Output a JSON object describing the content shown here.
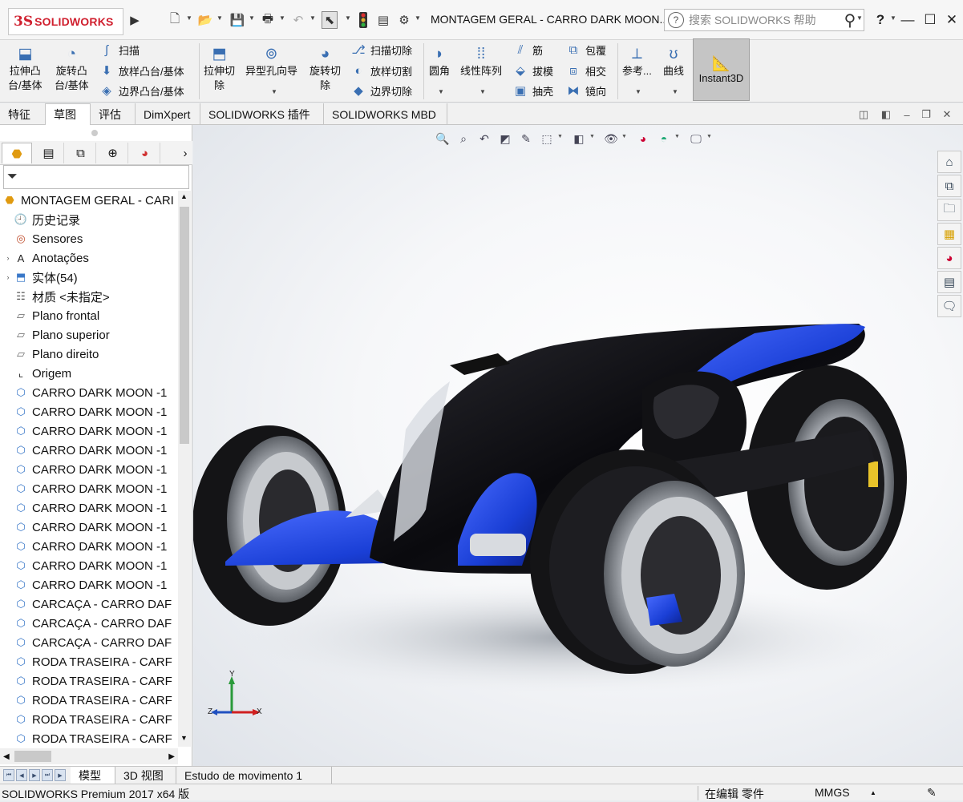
{
  "app": {
    "logo_mark": "3S",
    "logo_text": "SOLIDWORKS",
    "window_title": "MONTAGEM GERAL - CARRO DARK MOON...",
    "search_placeholder": "搜索 SOLIDWORKS 帮助",
    "help_glyph": "?"
  },
  "ribbon": {
    "extrude_boss": "拉伸凸\n台/基体",
    "revolve_boss": "旋转凸\n台/基体",
    "sweep": "扫描",
    "loft_boss": "放样凸台/基体",
    "boundary_boss": "边界凸台/基体",
    "extrude_cut": "拉伸切\n除",
    "hole_wizard": "异型孔向导",
    "revolve_cut": "旋转切\n除",
    "swept_cut": "扫描切除",
    "lofted_cut": "放样切割",
    "boundary_cut": "边界切除",
    "fillet": "圆角",
    "linear_pattern": "线性阵列",
    "rib": "筋",
    "draft": "拔模",
    "shell": "抽壳",
    "wrap": "包覆",
    "intersect": "相交",
    "mirror": "镜向",
    "reference": "参考...",
    "curves": "曲线",
    "instant3d": "Instant3D"
  },
  "command_tabs": [
    "特征",
    "草图",
    "评估",
    "DimXpert",
    "SOLIDWORKS 插件",
    "SOLIDWORKS MBD"
  ],
  "tree": {
    "root": "MONTAGEM GERAL - CARI",
    "items": [
      {
        "label": "历史记录",
        "icon": "history-icon",
        "exp": ""
      },
      {
        "label": "Sensores",
        "icon": "sensor-icon",
        "exp": ""
      },
      {
        "label": "Anotações",
        "icon": "annotation-icon",
        "exp": "›"
      },
      {
        "label": "实体(54)",
        "icon": "solid-bodies-icon",
        "exp": "›"
      },
      {
        "label": "材质 <未指定>",
        "icon": "material-icon",
        "exp": ""
      },
      {
        "label": "Plano frontal",
        "icon": "plane-icon",
        "exp": ""
      },
      {
        "label": "Plano superior",
        "icon": "plane-icon",
        "exp": ""
      },
      {
        "label": "Plano direito",
        "icon": "plane-icon",
        "exp": ""
      },
      {
        "label": "Origem",
        "icon": "origin-icon",
        "exp": ""
      },
      {
        "label": "CARRO DARK MOON -1",
        "icon": "part-icon",
        "exp": ""
      },
      {
        "label": "CARRO DARK MOON -1",
        "icon": "part-icon",
        "exp": ""
      },
      {
        "label": "CARRO DARK MOON -1",
        "icon": "part-icon",
        "exp": ""
      },
      {
        "label": "CARRO DARK MOON -1",
        "icon": "part-icon",
        "exp": ""
      },
      {
        "label": "CARRO DARK MOON -1",
        "icon": "part-icon",
        "exp": ""
      },
      {
        "label": "CARRO DARK MOON -1",
        "icon": "part-icon",
        "exp": ""
      },
      {
        "label": "CARRO DARK MOON -1",
        "icon": "part-icon",
        "exp": ""
      },
      {
        "label": "CARRO DARK MOON -1",
        "icon": "part-icon",
        "exp": ""
      },
      {
        "label": "CARRO DARK MOON -1",
        "icon": "part-icon",
        "exp": ""
      },
      {
        "label": "CARRO DARK MOON -1",
        "icon": "part-icon",
        "exp": ""
      },
      {
        "label": "CARRO DARK MOON -1",
        "icon": "part-icon",
        "exp": ""
      },
      {
        "label": "CARCAÇA - CARRO DAF",
        "icon": "part-icon",
        "exp": ""
      },
      {
        "label": "CARCAÇA - CARRO DAF",
        "icon": "part-icon",
        "exp": ""
      },
      {
        "label": "CARCAÇA - CARRO DAF",
        "icon": "part-icon",
        "exp": ""
      },
      {
        "label": "RODA TRASEIRA - CARF",
        "icon": "part-icon",
        "exp": ""
      },
      {
        "label": "RODA TRASEIRA - CARF",
        "icon": "part-icon",
        "exp": ""
      },
      {
        "label": "RODA TRASEIRA - CARF",
        "icon": "part-icon",
        "exp": ""
      },
      {
        "label": "RODA TRASEIRA - CARF",
        "icon": "part-icon",
        "exp": ""
      },
      {
        "label": "RODA TRASEIRA - CARF",
        "icon": "part-icon",
        "exp": ""
      }
    ]
  },
  "bottom_tabs": [
    "模型",
    "3D 视图",
    "Estudo de movimento 1"
  ],
  "status": {
    "product": "SOLIDWORKS Premium 2017 x64 版",
    "editing": "在编辑 零件",
    "units": "MMGS"
  },
  "triad": {
    "x": "X",
    "y": "Y",
    "z": "Z"
  },
  "colors": {
    "brand": "#d01f2e",
    "car_blue": "#1a3fd6",
    "car_black": "#0c0c10"
  }
}
